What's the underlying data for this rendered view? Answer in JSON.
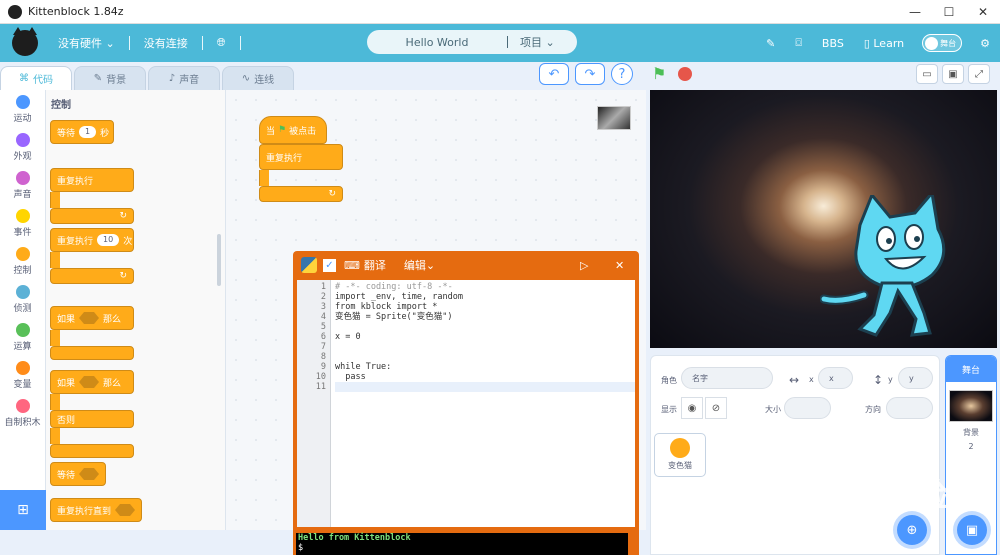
{
  "window": {
    "title": "Kittenblock 1.84z",
    "controls": [
      "—",
      "☐",
      "✕"
    ]
  },
  "menubar": {
    "hardware": "没有硬件",
    "connection": "没有连接",
    "project_name": "Hello World",
    "project_menu": "项目",
    "bbs": "BBS",
    "learn": "Learn",
    "stage_toggle": "舞台"
  },
  "tabs": [
    {
      "label": "代码"
    },
    {
      "label": "背景"
    },
    {
      "label": "声音"
    },
    {
      "label": "连线"
    }
  ],
  "categories": [
    {
      "label": "运动",
      "color": "#4c97ff"
    },
    {
      "label": "外观",
      "color": "#9966ff"
    },
    {
      "label": "声音",
      "color": "#cf63cf"
    },
    {
      "label": "事件",
      "color": "#ffd500"
    },
    {
      "label": "控制",
      "color": "#ffab19"
    },
    {
      "label": "侦测",
      "color": "#5cb1d6"
    },
    {
      "label": "运算",
      "color": "#59c059"
    },
    {
      "label": "变量",
      "color": "#ff8c1a"
    },
    {
      "label": "自制积木",
      "color": "#ff6680"
    }
  ],
  "palette": {
    "title": "控制",
    "wait": {
      "pre": "等待",
      "value": "1",
      "post": "秒"
    },
    "forever": "重复执行",
    "repeat": {
      "pre": "重复执行",
      "value": "10",
      "post": "次"
    },
    "if_then": {
      "pre": "如果",
      "post": "那么"
    },
    "if_else": {
      "pre": "如果",
      "post": "那么",
      "else": "否则"
    },
    "wait_until": "等待",
    "repeat_until": "重复执行直到"
  },
  "script": {
    "hat_pre": "当",
    "hat_post": "被点击",
    "loop": "重复执行"
  },
  "python_window": {
    "translate": "翻译",
    "edit": "编辑",
    "line_numbers": [
      "1",
      "2",
      "3",
      "4",
      "5",
      "6",
      "7",
      "8",
      "9",
      "10",
      "11"
    ],
    "code_lines": [
      {
        "t": "# -*- coding: utf-8 -*-",
        "c": "cm"
      },
      {
        "t": "import _env, time, random",
        "c": ""
      },
      {
        "t": "from kblock import *",
        "c": ""
      },
      {
        "t": "变色猫 = Sprite(\"变色猫\")",
        "c": ""
      },
      {
        "t": "",
        "c": ""
      },
      {
        "t": "x = 0",
        "c": ""
      },
      {
        "t": "",
        "c": ""
      },
      {
        "t": "",
        "c": ""
      },
      {
        "t": "while True:",
        "c": ""
      },
      {
        "t": "  pass",
        "c": ""
      },
      {
        "t": "",
        "c": "cur"
      }
    ],
    "console_line": "Hello from Kittenblock",
    "console_prompt": "$"
  },
  "sprite_info": {
    "sprite_label": "角色",
    "name_placeholder": "名字",
    "x_label": "x",
    "x_value": "x",
    "y_label": "y",
    "y_value": "y",
    "show_label": "显示",
    "size_label": "大小",
    "direction_label": "方向"
  },
  "sprites": [
    {
      "name": "变色猫"
    }
  ],
  "stage_pane": {
    "title": "舞台",
    "backdrop_label": "背景",
    "backdrop_count": "2"
  },
  "watermark": {
    "line1": "Baidu 经验",
    "line2": "jingyan.baidu.com"
  }
}
